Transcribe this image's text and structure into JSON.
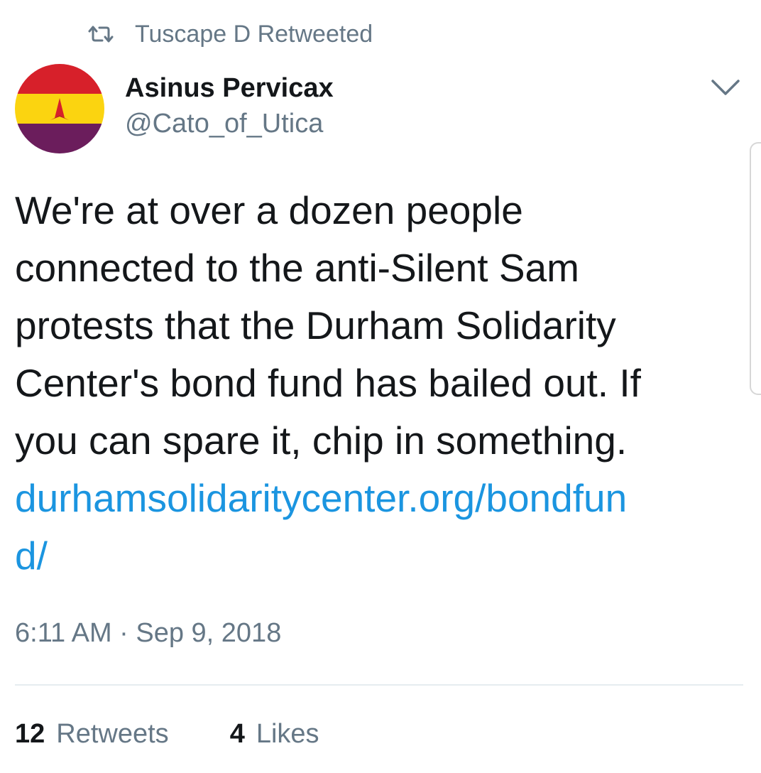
{
  "retweet_context": {
    "icon": "retweet-icon",
    "text": "Tuscape D Retweeted"
  },
  "tweet": {
    "author_name": "Asinus Pervicax",
    "author_handle": "@Cato_of_Utica",
    "text_lines": [
      "We're at over a dozen people",
      "connected to the anti-Silent Sam",
      "protests that the Durham Solidarity",
      "Center's bond fund has bailed out. If",
      "you can spare it, chip in something."
    ],
    "link_lines": [
      "durhamsolidaritycenter.org/bondfun",
      "d/"
    ],
    "timestamp": "6:11 AM · Sep 9, 2018",
    "retweets_count": "12",
    "retweets_label": "Retweets",
    "likes_count": "4",
    "likes_label": "Likes"
  },
  "colors": {
    "link": "#1b95e0",
    "secondary_text": "#657786",
    "primary_text": "#14171a",
    "avatar_red": "#d7202a",
    "avatar_yellow": "#fbd410",
    "avatar_purple": "#6b1d5c"
  }
}
